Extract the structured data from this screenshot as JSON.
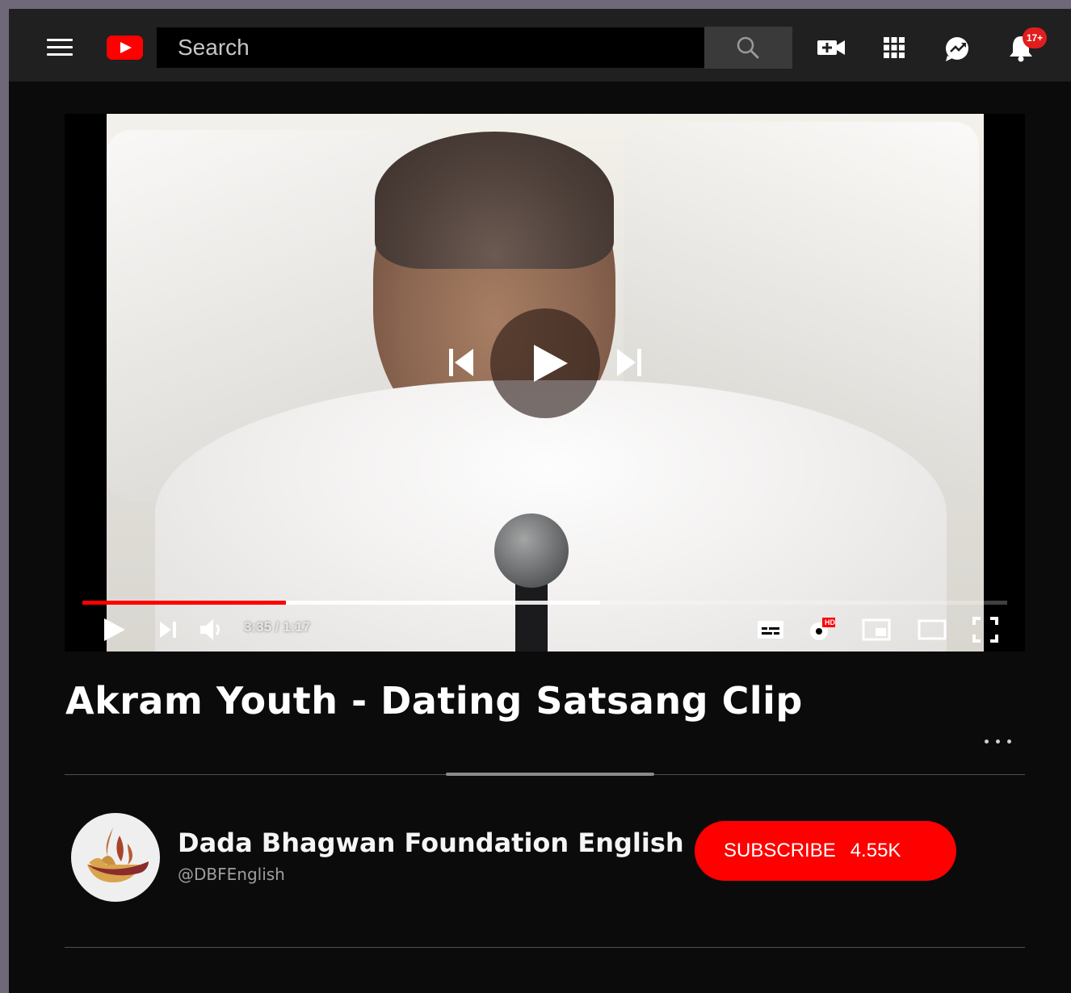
{
  "header": {
    "search": {
      "placeholder": "Search"
    },
    "notifications_badge": "17+",
    "icons": [
      "menu-icon",
      "youtube-logo",
      "search-icon",
      "video-add-icon",
      "apps-grid-icon",
      "messages-icon",
      "bell-icon"
    ]
  },
  "player": {
    "time": "3:35 / 1:17",
    "progress_played": 0.22,
    "progress_buffered": 0.56,
    "quality_badge": "HD"
  },
  "video": {
    "title": "Akram Youth - Dating Satsang Clip"
  },
  "channel": {
    "name": "Dada Bhagwan Foundation English",
    "handle": "@DBFEnglish"
  },
  "subscribe": {
    "label": "SUBSCRIBE",
    "count": "4.55K"
  },
  "colors": {
    "accent": "#ff0000",
    "background": "#0b0b0b",
    "topbar": "#202020",
    "outer_frame": "#6e6878"
  }
}
